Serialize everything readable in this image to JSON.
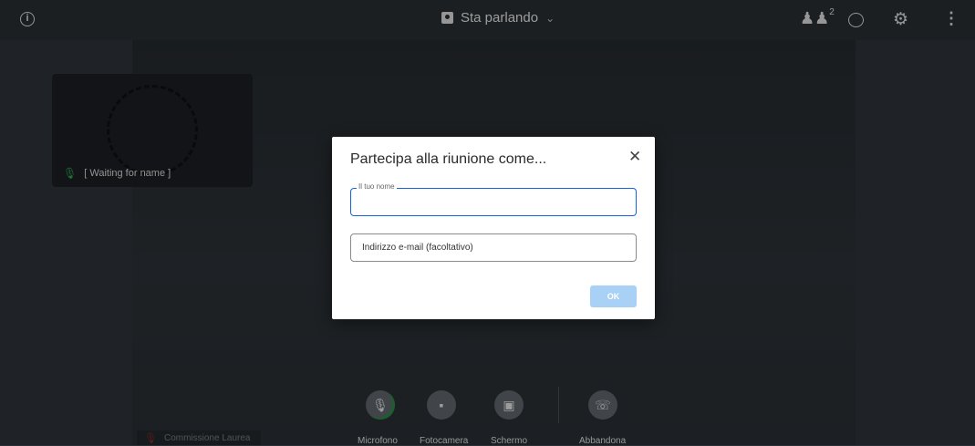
{
  "topbar": {
    "speaker_view_label": "Sta parlando",
    "participants_count": "2"
  },
  "tile": {
    "name": "[ Waiting for name ]"
  },
  "modal": {
    "title": "Partecipa alla riunione come...",
    "name_label": "Il tuo nome",
    "name_value": "",
    "email_placeholder": "Indirizzo e-mail (facoltativo)",
    "ok_label": "OK"
  },
  "toolbar": {
    "microphone": "Microfono",
    "camera": "Fotocamera",
    "screen": "Schermo",
    "leave": "Abbandona"
  },
  "local": {
    "name": "Commissione Laurea"
  },
  "colors": {
    "accent": "#1863d6",
    "ok_button": "#a9d0f5",
    "mic_active": "#2fae5a"
  }
}
